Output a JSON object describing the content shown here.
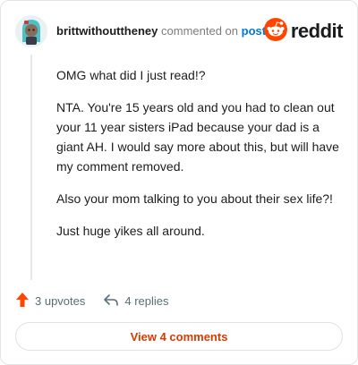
{
  "header": {
    "username": "brittwithouttheney",
    "commented_on": "commented on",
    "post_link": "post",
    "brand": "reddit"
  },
  "comment": {
    "paragraphs": [
      "OMG what did I just read!?",
      "NTA. You're 15 years old and you had to clean out your 11 year sisters iPad because your dad is a giant AH. I would say more about this, but will have my comment removed.",
      "Also your mom talking to you about their sex life?!",
      "Just huge yikes all around."
    ]
  },
  "actions": {
    "upvotes": "3 upvotes",
    "replies": "4 replies"
  },
  "view_comments": "View 4 comments",
  "colors": {
    "upvote": "#ff4500",
    "link": "#0079d3",
    "view_button_text": "#d93a00",
    "muted": "#576f76"
  },
  "icons": [
    "avatar",
    "reddit-logo-icon",
    "upvote-arrow-icon",
    "reply-arrow-icon"
  ]
}
